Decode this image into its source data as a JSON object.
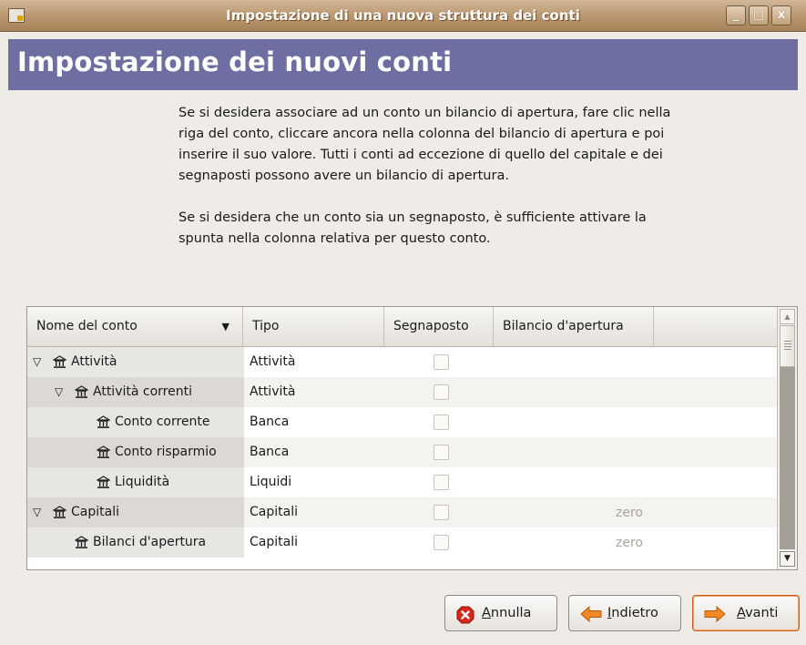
{
  "window": {
    "title": "Impostazione di una nuova struttura dei conti",
    "controls": {
      "minimize": "_",
      "maximize": "□",
      "close": "x"
    }
  },
  "page": {
    "heading": "Impostazione dei nuovi conti",
    "description": [
      "Se si desidera associare ad un conto un bilancio di apertura, fare clic nella riga del conto, cliccare ancora nella colonna del bilancio di apertura e poi inserire il suo valore. Tutti i conti ad eccezione di quello del capitale e dei segnaposti possono avere un bilancio di apertura.",
      "Se si desidera che un conto sia un segnaposto, è sufficiente attivare la spunta nella colonna relativa per questo conto."
    ]
  },
  "table": {
    "columns": [
      "Nome del conto",
      "Tipo",
      "Segnaposto",
      "Bilancio d'apertura"
    ],
    "sort_arrow": "▼",
    "rows": [
      {
        "name": "Attività",
        "type": "Attività",
        "placeholder": false,
        "balance": "",
        "level": 0,
        "expanded": true
      },
      {
        "name": "Attività correnti",
        "type": "Attività",
        "placeholder": false,
        "balance": "",
        "level": 1,
        "expanded": true
      },
      {
        "name": "Conto corrente",
        "type": "Banca",
        "placeholder": false,
        "balance": "",
        "level": 2
      },
      {
        "name": "Conto risparmio",
        "type": "Banca",
        "placeholder": false,
        "balance": "",
        "level": 2
      },
      {
        "name": "Liquidità",
        "type": "Liquidi",
        "placeholder": false,
        "balance": "",
        "level": 2
      },
      {
        "name": "Capitali",
        "type": "Capitali",
        "placeholder": false,
        "balance": "zero",
        "level": 0,
        "expanded": true
      },
      {
        "name": "Bilanci d'apertura",
        "type": "Capitali",
        "placeholder": false,
        "balance": "zero",
        "level": 1
      }
    ],
    "expander_glyph": "▽"
  },
  "buttons": {
    "cancel": {
      "mnemonic": "A",
      "rest": "nnulla"
    },
    "back": {
      "mnemonic": "I",
      "rest": "ndietro"
    },
    "next": {
      "mnemonic": "A",
      "rest": "vanti"
    }
  },
  "colors": {
    "header": "#6f6ea2",
    "titlebar": "#b8956d",
    "cancel_icon": "#d9271b",
    "arrow_icon": "#f08a24"
  }
}
